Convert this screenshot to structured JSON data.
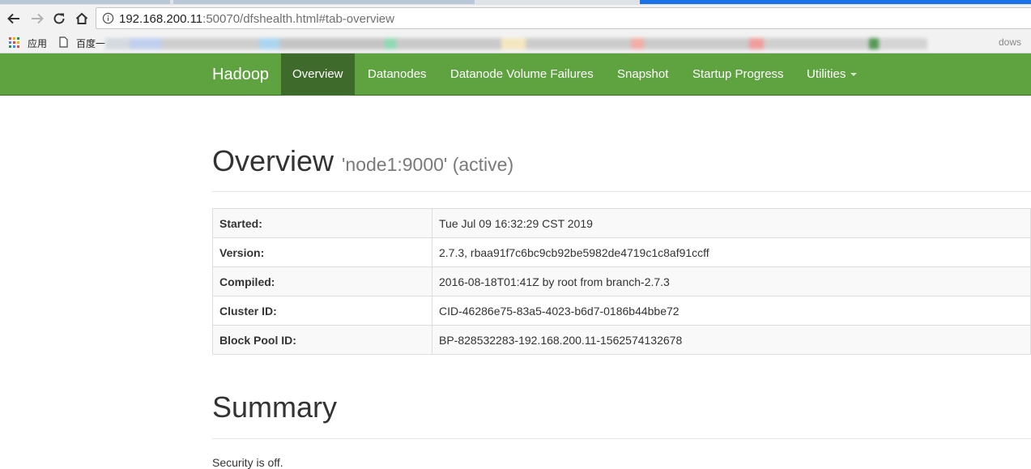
{
  "browser": {
    "url_host": "192.168.200.11",
    "url_rest": ":50070/dfshealth.html#tab-overview",
    "bookmarks": {
      "apps_label": "应用",
      "first_label": "百度一",
      "last_label": "dows"
    }
  },
  "navbar": {
    "brand": "Hadoop",
    "items": [
      {
        "label": "Overview"
      },
      {
        "label": "Datanodes"
      },
      {
        "label": "Datanode Volume Failures"
      },
      {
        "label": "Snapshot"
      },
      {
        "label": "Startup Progress"
      },
      {
        "label": "Utilities"
      }
    ]
  },
  "overview": {
    "title": "Overview",
    "subtitle": "'node1:9000' (active)",
    "rows": [
      {
        "key": "Started:",
        "value": "Tue Jul 09 16:32:29 CST 2019"
      },
      {
        "key": "Version:",
        "value": "2.7.3, rbaa91f7c6bc9cb92be5982de4719c1c8af91ccff"
      },
      {
        "key": "Compiled:",
        "value": "2016-08-18T01:41Z by root from branch-2.7.3"
      },
      {
        "key": "Cluster ID:",
        "value": "CID-46286e75-83a5-4023-b6d7-0186b44bbe72"
      },
      {
        "key": "Block Pool ID:",
        "value": "BP-828532283-192.168.200.11-1562574132678"
      }
    ]
  },
  "summary": {
    "title": "Summary",
    "security": "Security is off."
  },
  "colors": {
    "navbar_bg": "#5fa341",
    "navbar_active": "#3e6b2b"
  }
}
